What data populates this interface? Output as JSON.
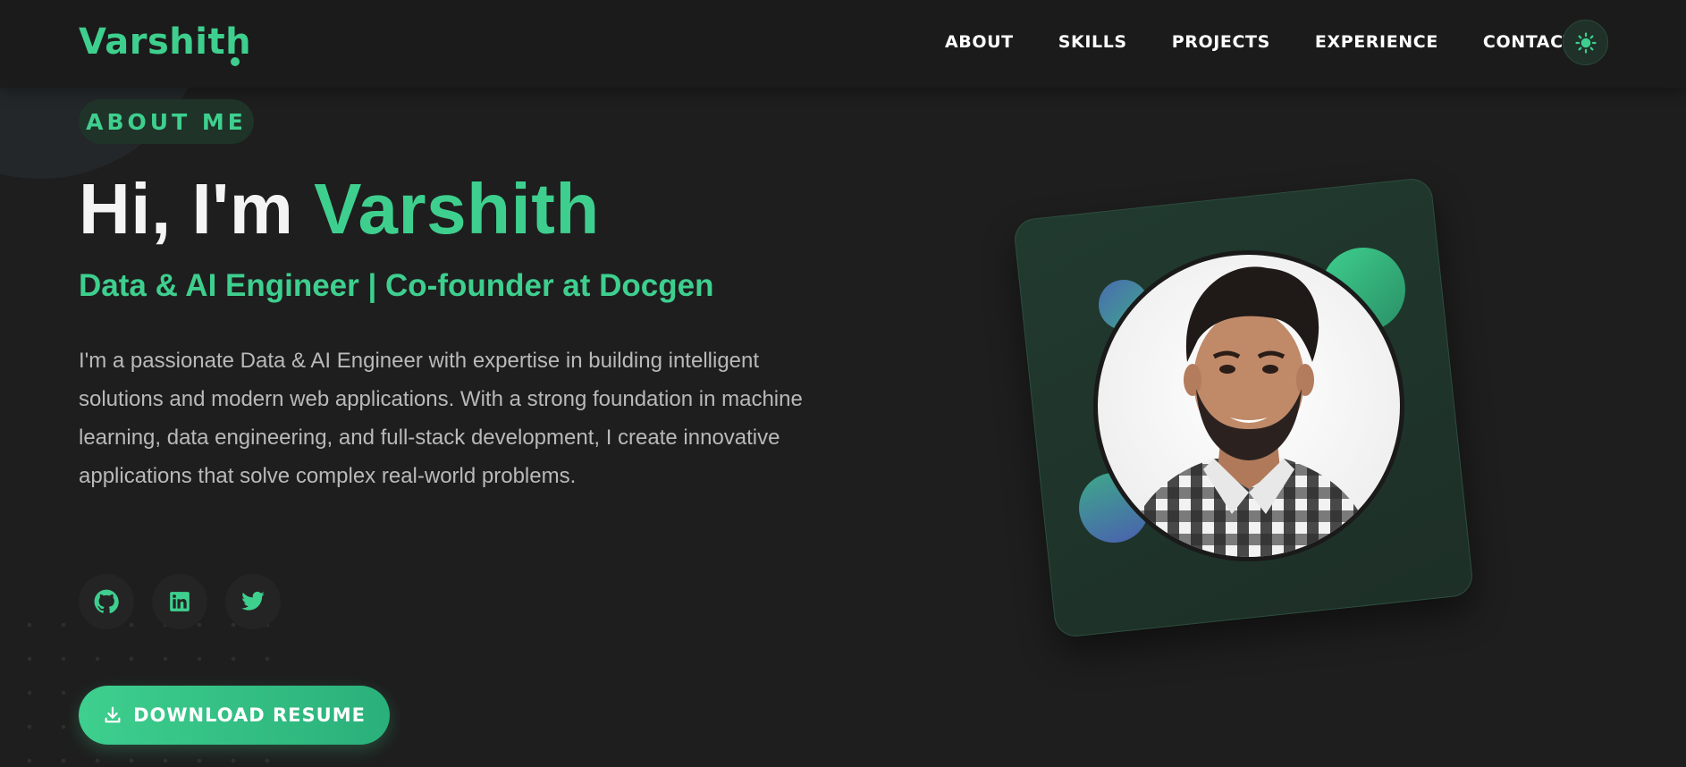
{
  "nav": {
    "brand": "Varshith",
    "links": [
      "ABOUT",
      "SKILLS",
      "PROJECTS",
      "EXPERIENCE",
      "CONTACT"
    ],
    "theme_toggle_icon": "sun-icon"
  },
  "hero": {
    "badge": "ABOUT ME",
    "greeting": "Hi, I'm",
    "name": "Varshith",
    "subtitle": "Data & AI Engineer | Co-founder at Docgen",
    "bio": "I'm a passionate Data & AI Engineer with expertise in building intelligent solutions and modern web applications. With a strong foundation in machine learning, data engineering, and full-stack development, I create innovative applications that solve complex real-world problems.",
    "socials": [
      {
        "icon": "github-icon"
      },
      {
        "icon": "linkedin-icon"
      },
      {
        "icon": "twitter-icon"
      }
    ],
    "download_button": "DOWNLOAD RESUME"
  },
  "colors": {
    "accent": "#3ecf8e",
    "background": "#1e1e1e"
  }
}
